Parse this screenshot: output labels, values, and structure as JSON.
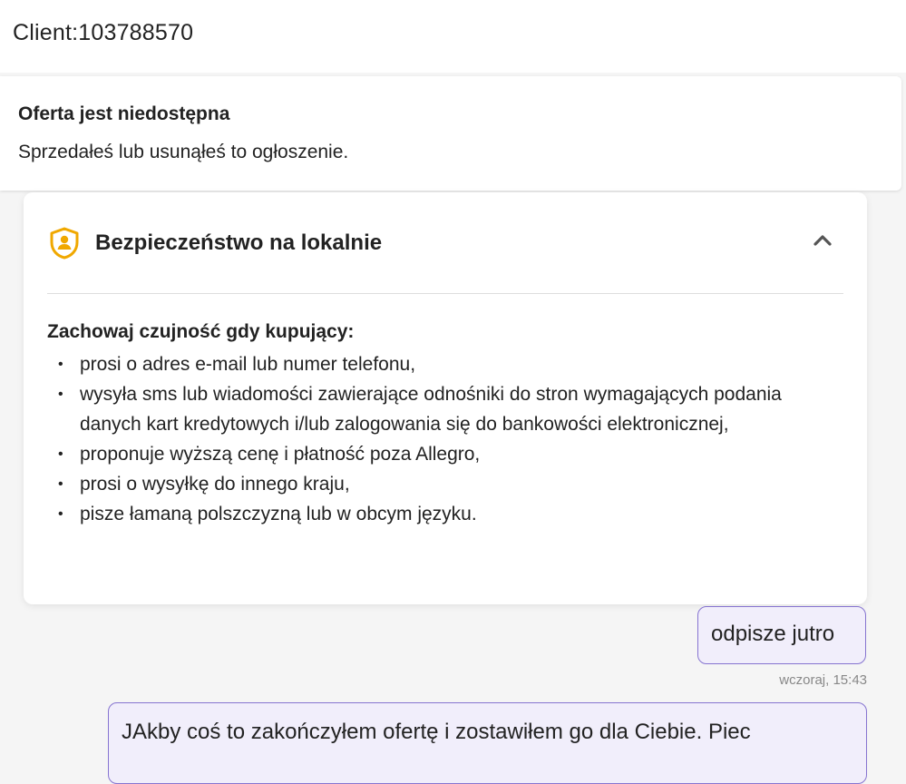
{
  "header": {
    "client_label": "Client:103788570"
  },
  "offer_banner": {
    "title": "Oferta jest niedostępna",
    "subtitle": "Sprzedałeś lub usunąłeś to ogłoszenie."
  },
  "safety": {
    "title": "Bezpieczeństwo na lokalnie",
    "heading": "Zachowaj czujność gdy kupujący:",
    "items": [
      "prosi o adres e-mail lub numer telefonu,",
      "wysyła sms lub wiadomości zawierające odnośniki do stron wymagających podania danych kart kredytowych i/lub zalogowania się do bankowości elektronicznej,",
      "proponuje wyższą cenę i płatność poza Allegro,",
      "prosi o wysyłkę do innego kraju,",
      "pisze łamaną polszczyzną lub w obcym języku."
    ],
    "icon": "shield-user-icon",
    "toggle_icon": "chevron-up-icon",
    "accent_color": "#f0a800"
  },
  "messages": [
    {
      "text": "odpisze jutro",
      "time": "wczoraj, 15:43"
    },
    {
      "text": "JAkby coś to zakończyłem ofertę i zostawiłem go dla Ciebie. Piec"
    }
  ],
  "colors": {
    "bubble_bg": "#f1eefb",
    "bubble_border": "#8674d0",
    "page_bg": "#f5f5f5"
  }
}
